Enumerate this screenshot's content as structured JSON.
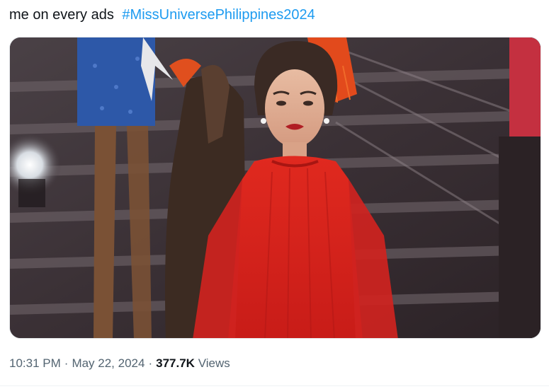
{
  "tweet": {
    "text": "me on every ads",
    "hashtag": "#MissUniversePhilippines2024",
    "time": "10:31 PM",
    "separator": "·",
    "date": "May 22, 2024",
    "views_count": "377.7K",
    "views_label": "Views"
  },
  "colors": {
    "text": "#0f1419",
    "hashtag": "#1d9bf0",
    "meta": "#536471",
    "dress": "#d9231f"
  }
}
